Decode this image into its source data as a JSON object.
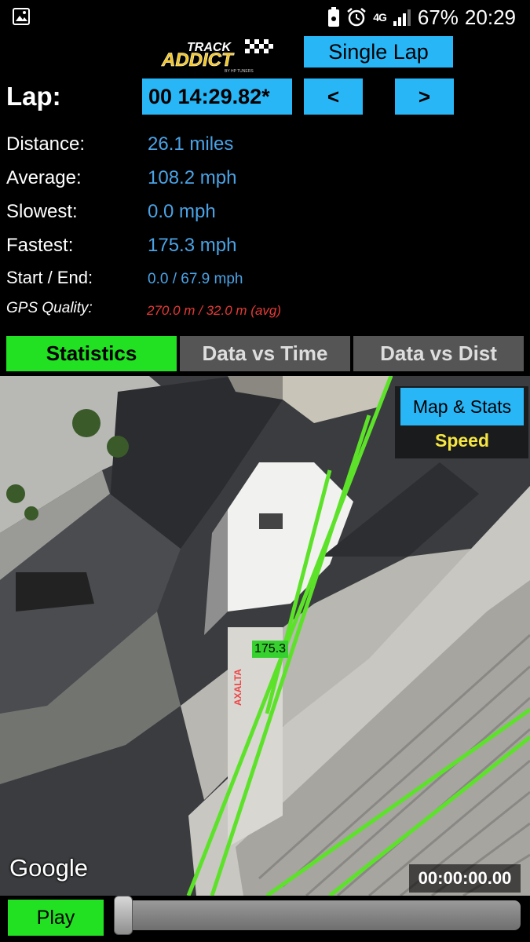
{
  "status_bar": {
    "icons": [
      "image-icon",
      "battery-saver-icon",
      "alarm-icon",
      "network-4g-icon",
      "signal-icon"
    ],
    "network_label": "4G",
    "battery_pct": "67%",
    "time": "20:29"
  },
  "header": {
    "logo_top": "TRACK",
    "logo_main": "ADDICT",
    "logo_sub": "BY HP TUNERS",
    "mode_button": "Single Lap"
  },
  "lap": {
    "label": "Lap:",
    "value": "00  14:29.82*",
    "prev_label": "<",
    "next_label": ">"
  },
  "stats": {
    "distance_label": "Distance:",
    "distance_value": "26.1 miles",
    "average_label": "Average:",
    "average_value": "108.2 mph",
    "slowest_label": "Slowest:",
    "slowest_value": "0.0 mph",
    "fastest_label": "Fastest:",
    "fastest_value": "175.3 mph",
    "startend_label": "Start / End:",
    "startend_value": "0.0 / 67.9 mph",
    "gps_label": "GPS Quality:",
    "gps_value": "270.0 m / 32.0 m (avg)"
  },
  "tabs": [
    {
      "label": "Statistics",
      "active": true
    },
    {
      "label": "Data vs Time",
      "active": false
    },
    {
      "label": "Data vs Dist",
      "active": false
    }
  ],
  "map": {
    "mode_button": "Map & Stats",
    "overlay_label": "Speed",
    "speed_tag": "175.3",
    "attribution": "Google",
    "timecode": "00:00:00.00",
    "building_sign": "AXALTA",
    "track_color": "#5de22a"
  },
  "playback": {
    "play_label": "Play",
    "position_fraction": 0.0
  },
  "colors": {
    "accent_blue": "#29b6f6",
    "accent_green": "#22e022",
    "value_blue": "#4aa3e6",
    "gps_red": "#e53935",
    "speed_yellow": "#f5e642"
  }
}
